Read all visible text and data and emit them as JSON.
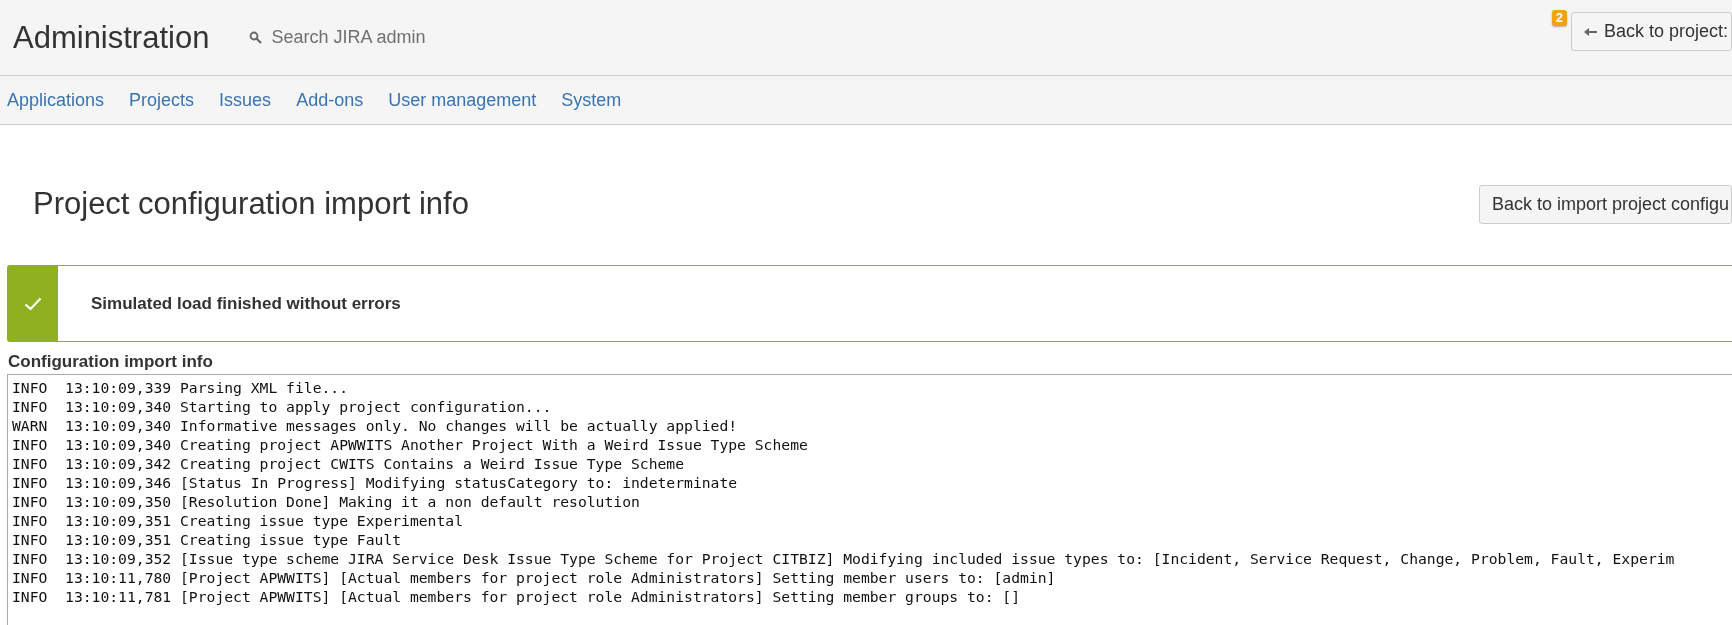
{
  "header": {
    "title": "Administration",
    "search": {
      "placeholder": "Search JIRA admin"
    },
    "badge": "2",
    "back_button": "Back to project:"
  },
  "nav": [
    {
      "label": "Applications"
    },
    {
      "label": "Projects"
    },
    {
      "label": "Issues"
    },
    {
      "label": "Add-ons"
    },
    {
      "label": "User management"
    },
    {
      "label": "System"
    }
  ],
  "page": {
    "title": "Project configuration import info",
    "back_button": "Back to import project configu"
  },
  "alert": {
    "kind": "success",
    "message": "Simulated load finished without errors"
  },
  "log": {
    "heading": "Configuration import info",
    "lines": [
      {
        "text": "INFO  13:10:09,339 Parsing XML file..."
      },
      {
        "text": "INFO  13:10:09,340 Starting to apply project configuration..."
      },
      {
        "text": "WARN  13:10:09,340 Informative messages only. No changes will be actually applied!"
      },
      {
        "text": "INFO  13:10:09,340 Creating project APWWITS Another Project With a Weird Issue Type Scheme"
      },
      {
        "text": "INFO  13:10:09,342 Creating project CWITS Contains a Weird Issue Type Scheme"
      },
      {
        "text": "INFO  13:10:09,346 [Status In Progress] Modifying statusCategory to: indeterminate"
      },
      {
        "text": "INFO  13:10:09,350 [Resolution Done] Making it a non default resolution"
      },
      {
        "text": "INFO  13:10:09,351 Creating issue type Experimental"
      },
      {
        "text": "INFO  13:10:09,351 Creating issue type Fault"
      },
      {
        "text": "INFO  13:10:09,352 [Issue type scheme JIRA Service Desk Issue Type Scheme for Project CITBIZ] Modifying included issue types to: [Incident, Service Request, Change, Problem, Fault, Experim"
      },
      {
        "text": "INFO  13:10:11,780 [Project APWWITS] [Actual members for project role Administrators] Setting member users to: [admin]"
      },
      {
        "text": "INFO  13:10:11,781 [Project APWWITS] [Actual members for project role Administrators] Setting member groups to: []"
      }
    ]
  }
}
